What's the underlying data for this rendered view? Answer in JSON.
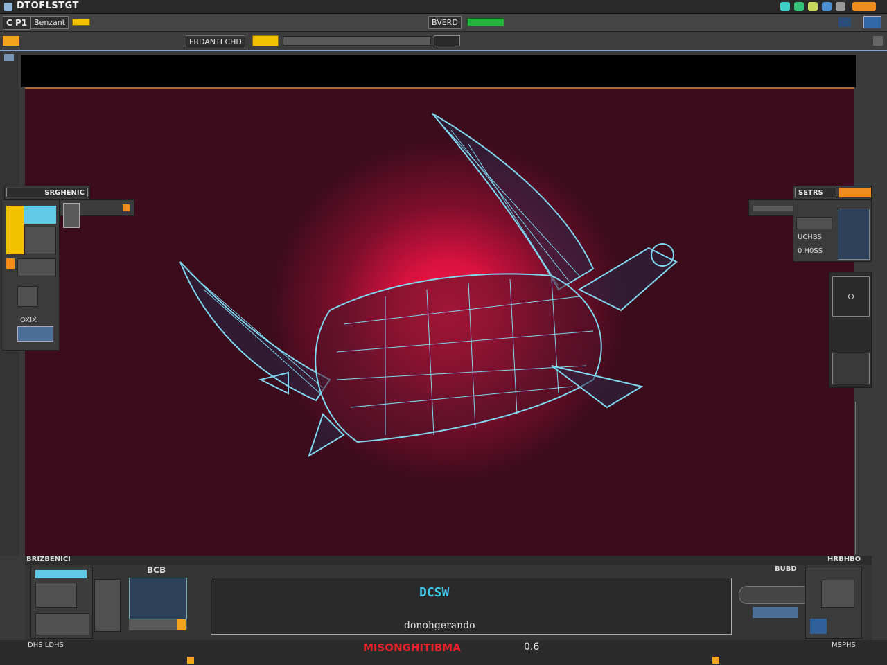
{
  "window": {
    "title": "DTOFLSTGT"
  },
  "menubar": {
    "left_label": "C P1",
    "doc_label": "Benzant",
    "center_label": "BVERD"
  },
  "toolbar": {
    "field_label": "FRDANTI CHD"
  },
  "left_panel": {
    "title": "SRGHENIC",
    "section_label": "OXIX"
  },
  "right_panel": {
    "title": "SETRS",
    "row1_label": "UCHBS",
    "row2_label": "0 H0SS"
  },
  "bottom": {
    "left_title": "BRIZBENICI",
    "right_title": "HRBHBO",
    "grid_title": "BCB",
    "right_box_title": "BUBD",
    "console_heading": "DCSW",
    "console_text": "donohgerando"
  },
  "status": {
    "left_text": "DHS LDHS",
    "center_text": "MISONGHITIBMA",
    "center_value": "0.6",
    "right_text": "MSPHS"
  },
  "colors": {
    "accent_yellow": "#f2c100",
    "accent_orange": "#f08c1e",
    "wireframe_cyan": "#7fd8f0",
    "status_red": "#e8222a",
    "background_glow": "#ff1a4a"
  },
  "icons": [
    "sword-wireframe-model",
    "gear-icon",
    "close-icon",
    "folder-icon",
    "search-icon",
    "maximize-icon",
    "play-icon"
  ]
}
